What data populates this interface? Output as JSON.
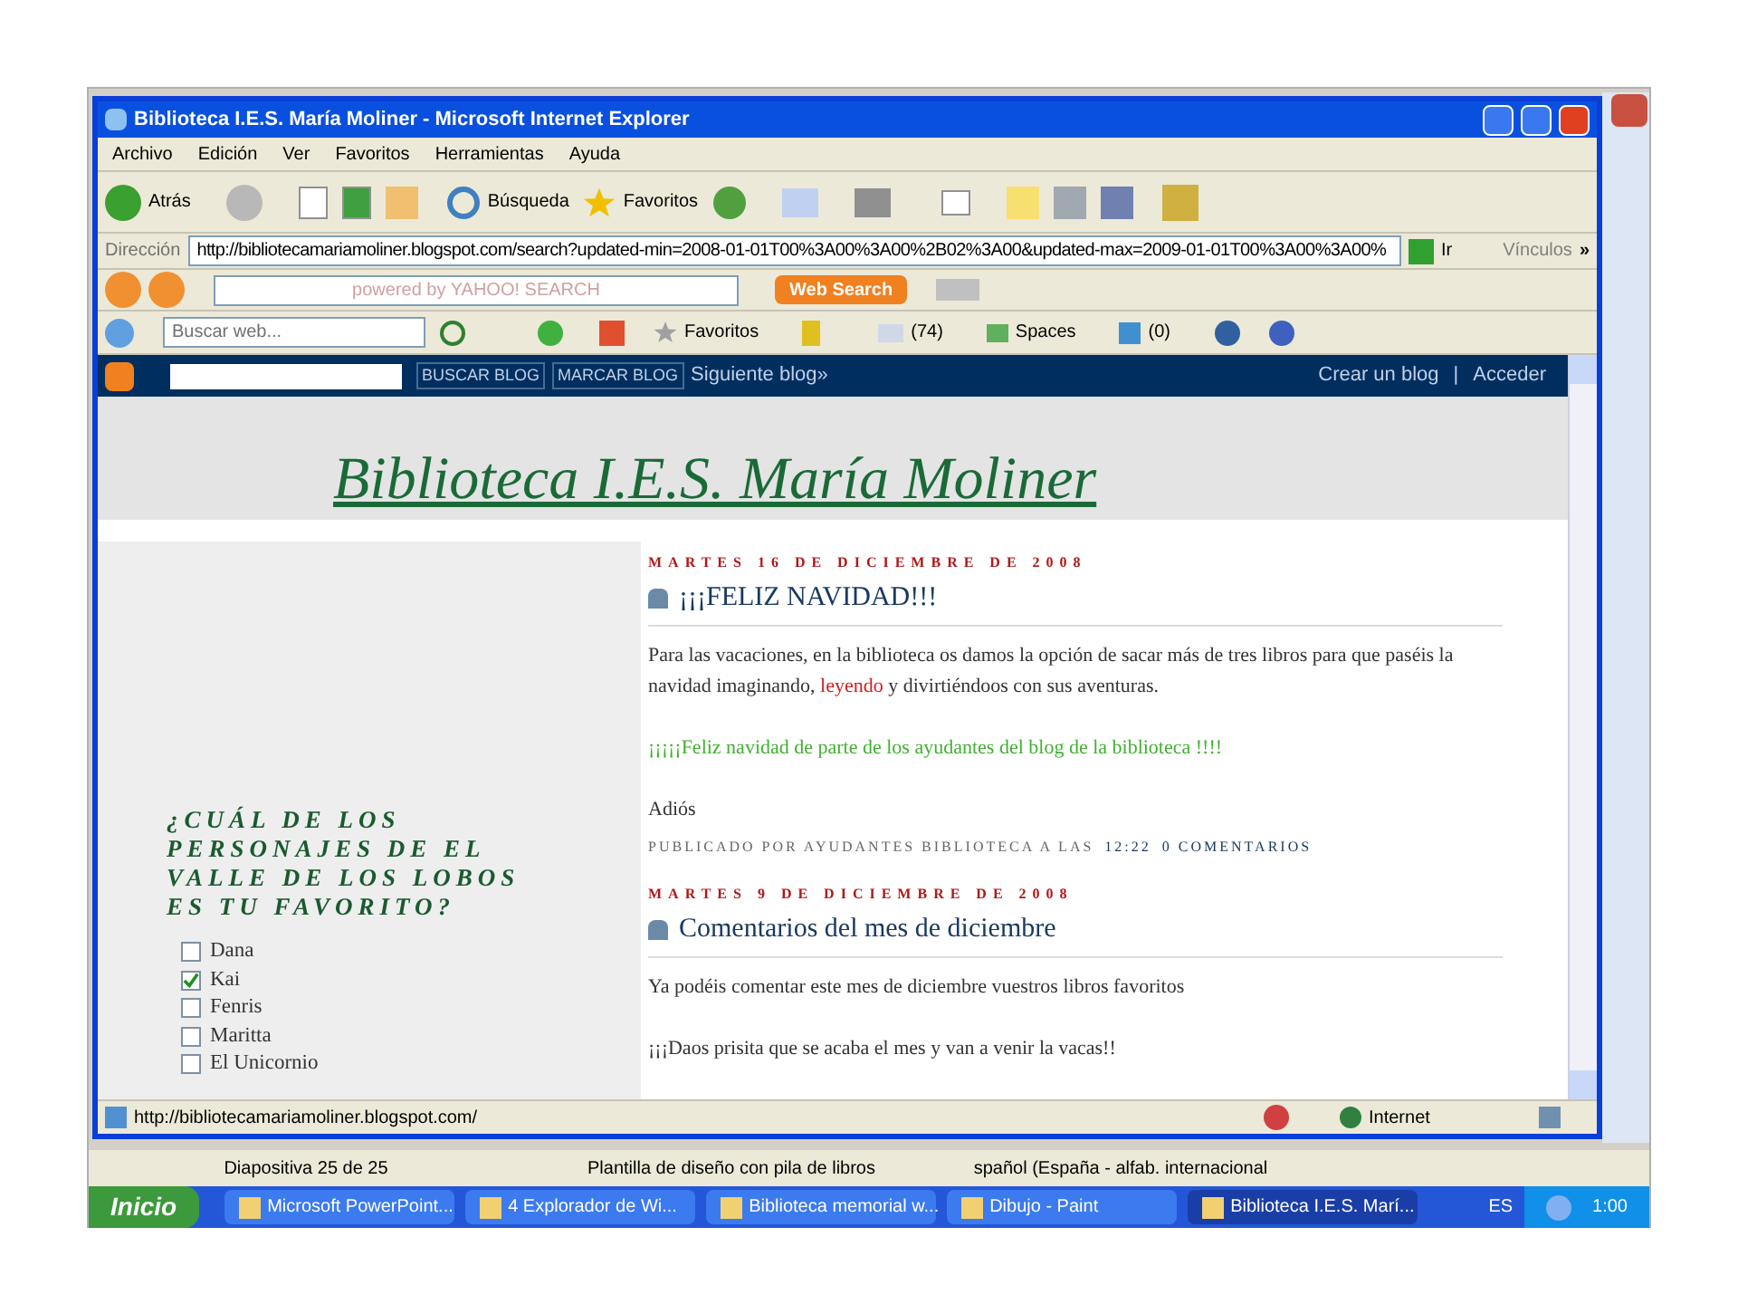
{
  "window": {
    "title": "Biblioteca I.E.S. María Moliner - Microsoft Internet Explorer"
  },
  "menu": [
    "Archivo",
    "Edición",
    "Ver",
    "Favoritos",
    "Herramientas",
    "Ayuda"
  ],
  "toolbar": {
    "back": "Atrás",
    "search": "Búsqueda",
    "favorites": "Favoritos"
  },
  "address": {
    "label": "Dirección",
    "value": "http://bibliotecamariamoliner.blogspot.com/search?updated-min=2008-01-01T00%3A00%3A00%2B02%3A00&updated-max=2009-01-01T00%3A00%3A00%",
    "go": "Ir",
    "links": "Vínculos",
    "more": "»"
  },
  "yahoo_toolbar": {
    "placeholder": "powered by YAHOO! SEARCH",
    "button": "Web Search"
  },
  "msn_toolbar": {
    "placeholder": "Buscar web...",
    "favorites": "Favoritos",
    "mail_count": "(74)",
    "spaces": "Spaces",
    "contacts": "(0)"
  },
  "navbar": {
    "buttons": [
      "BUSCAR BLOG",
      "MARCAR BLOG"
    ],
    "next": "Siguiente blog»",
    "create": "Crear un blog",
    "separator": "|",
    "login": "Acceder"
  },
  "blog": {
    "title": "Biblioteca I.E.S. María Moliner"
  },
  "poll": {
    "question": "¿CUÁL DE LOS PERSONAJES DE EL VALLE DE LOS LOBOS ES TU FAVORITO?",
    "options": [
      {
        "label": "Dana",
        "checked": false
      },
      {
        "label": "Kai",
        "checked": true
      },
      {
        "label": "Fenris",
        "checked": false
      },
      {
        "label": "Maritta",
        "checked": false
      },
      {
        "label": "El Unicornio",
        "checked": false
      }
    ]
  },
  "posts": [
    {
      "date": "MARTES 16 DE DICIEMBRE DE 2008",
      "title": "¡¡¡FELIZ NAVIDAD!!!",
      "paragraphs": [
        {
          "kind": "mixed",
          "parts": [
            {
              "text": "Para las vacaciones, en la biblioteca os damos la opción de sacar más de tres libros para que paséis la navidad imaginando, ",
              "link": false
            },
            {
              "text": "leyendo",
              "link": true
            },
            {
              "text": " y divirtiéndoos con sus aventuras.",
              "link": false
            }
          ]
        },
        {
          "kind": "greeting",
          "text": "¡¡¡¡¡Feliz navidad de parte de los ayudantes del blog de la biblioteca !!!!"
        },
        {
          "kind": "plain",
          "text": "Adiós"
        }
      ],
      "footer": {
        "by": "PUBLICADO POR AYUDANTES BIBLIOTECA A LAS",
        "time": "12:22",
        "comments": "0 COMENTARIOS"
      }
    },
    {
      "date": "MARTES 9 DE DICIEMBRE DE 2008",
      "title": "Comentarios del mes de diciembre",
      "paragraphs": [
        {
          "kind": "plain",
          "text": "Ya podéis comentar este mes de diciembre vuestros libros favoritos"
        },
        {
          "kind": "plain",
          "text": "¡¡¡Daos prisita que se acaba el mes y van a venir la vacas!!"
        }
      ]
    }
  ],
  "status_bar": {
    "url": "http://bibliotecamariamoliner.blogspot.com/",
    "zone": "Internet"
  },
  "ppt_status": [
    "Diapositiva 25 de 25",
    "Plantilla de diseño con pila de libros",
    "spañol (España - alfab. internacional"
  ],
  "taskbar": {
    "start": "Inicio",
    "items": [
      {
        "label": "Microsoft PowerPoint...",
        "selected": false
      },
      {
        "label": "4 Explorador de Wi...",
        "selected": false
      },
      {
        "label": "Biblioteca memorial w...",
        "selected": false
      },
      {
        "label": "Dibujo - Paint",
        "selected": false
      },
      {
        "label": "Biblioteca I.E.S. Marí...",
        "selected": true
      }
    ],
    "lang": "ES",
    "clock": "1:00"
  }
}
